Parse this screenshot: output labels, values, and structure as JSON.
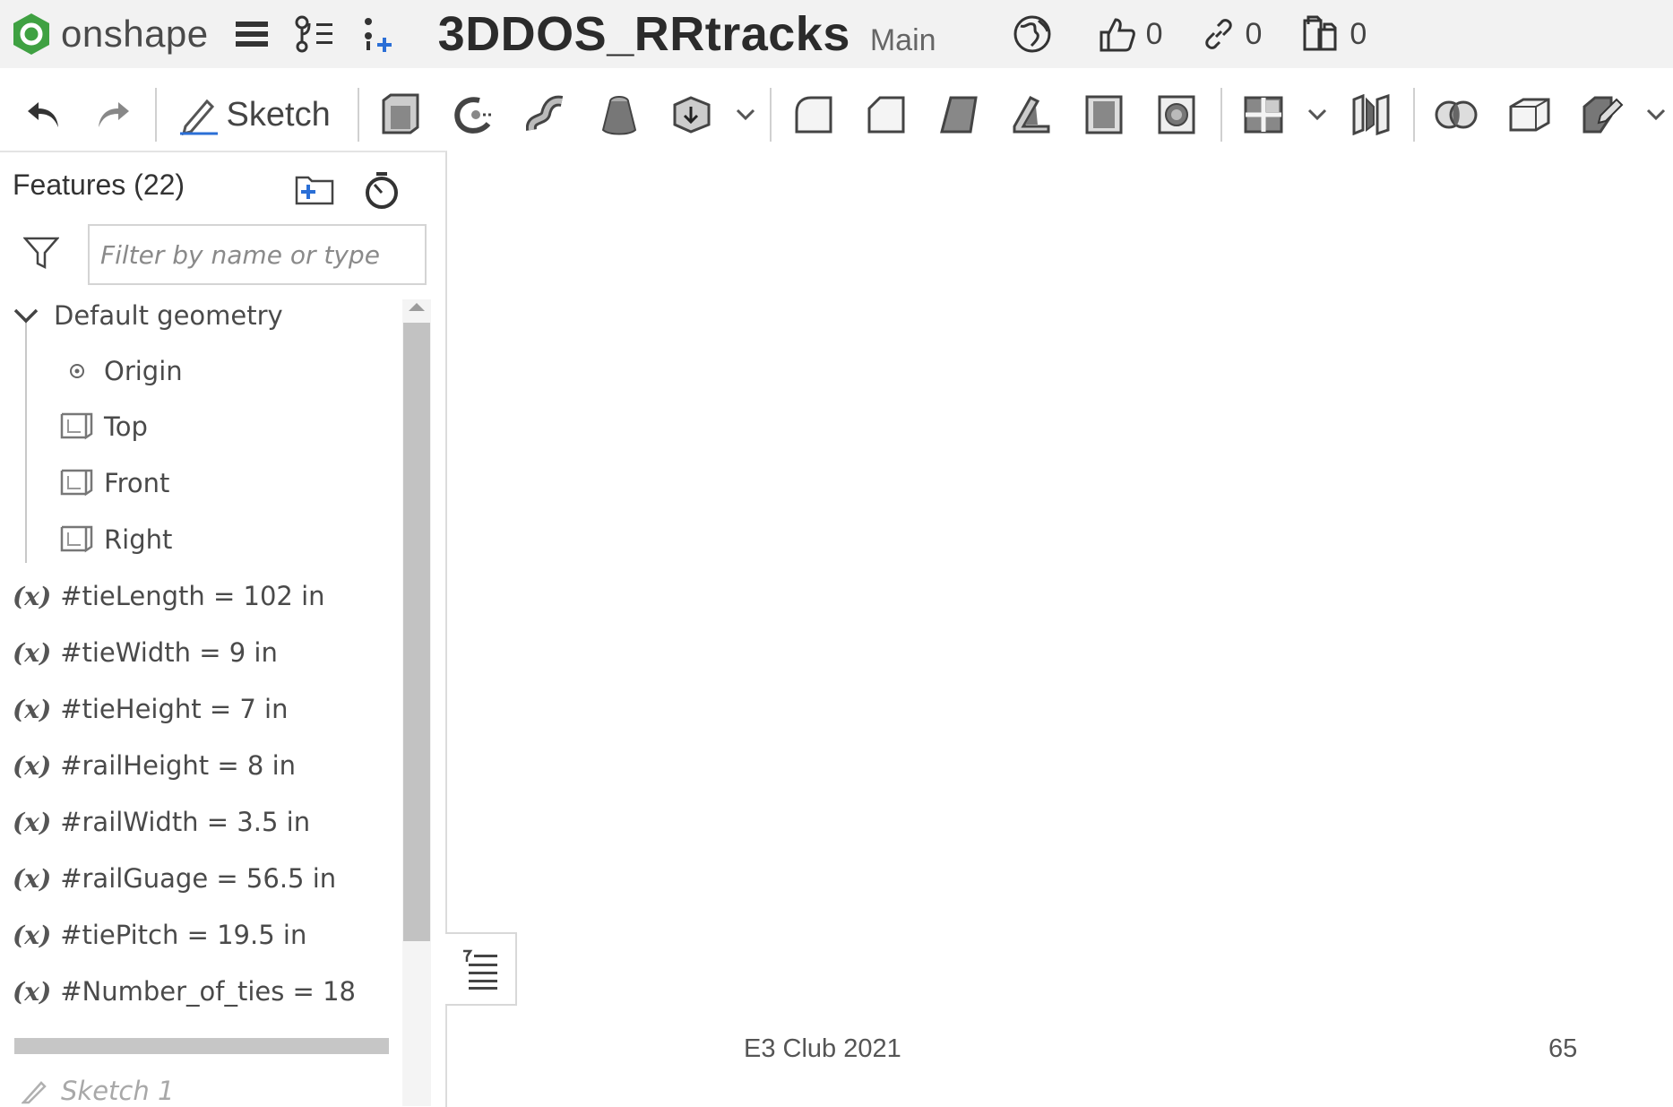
{
  "header": {
    "logo_text": "onshape",
    "document_title": "3DDOS_RRtracks",
    "branch": "Main",
    "likes": "0",
    "links": "0",
    "copies": "0"
  },
  "toolbar": {
    "sketch_label": "Sketch"
  },
  "features": {
    "title": "Features (22)",
    "filter_placeholder": "Filter by name or type",
    "default_geometry": "Default geometry",
    "planes": [
      "Origin",
      "Top",
      "Front",
      "Right"
    ],
    "variables": [
      "#tieLength = 102 in",
      "#tieWidth = 9 in",
      "#tieHeight = 7 in",
      "#railHeight = 8 in",
      "#railWidth = 3.5 in",
      "#railGuage = 56.5 in",
      "#tiePitch = 19.5 in",
      "#Number_of_ties = 18"
    ],
    "variable_symbol": "(x)",
    "suppressed_feature": "Sketch 1"
  },
  "slide": {
    "footer": "E3 Club 2021",
    "page_number": "65"
  },
  "colors": {
    "logo_green": "#3fa142",
    "accent_blue": "#2b6fd6",
    "icon_gray": "#5a5a5a"
  }
}
